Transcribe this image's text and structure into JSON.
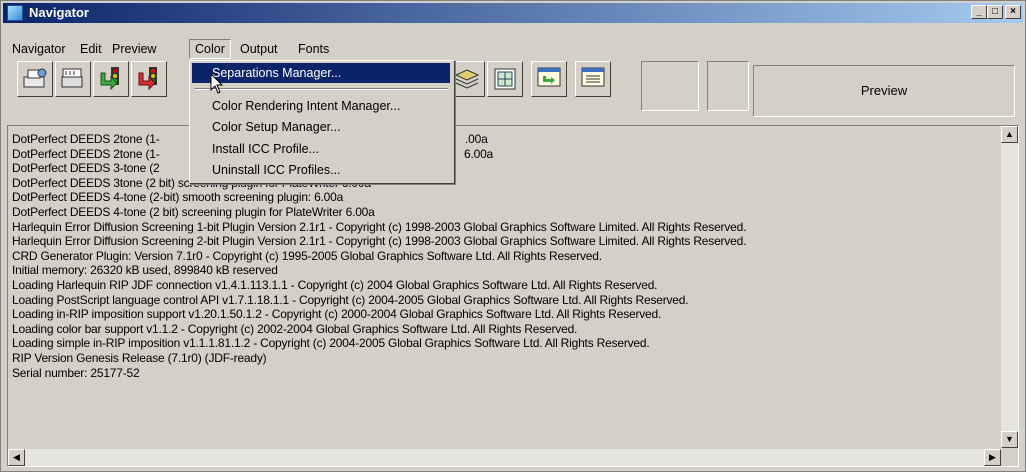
{
  "window": {
    "title": "Navigator"
  },
  "titlebar_buttons": {
    "minimize": "_",
    "maximize": "□",
    "close": "×"
  },
  "menubar": {
    "items": [
      {
        "label": "Navigator"
      },
      {
        "label": "Edit"
      },
      {
        "label": "Preview"
      },
      {
        "label": "Color"
      },
      {
        "label": "Output"
      },
      {
        "label": "Fonts"
      }
    ]
  },
  "toolbar": {
    "icons": [
      "print-job-icon",
      "tape-printer-icon",
      "traffic-light-green-arrow-icon",
      "traffic-light-red-arrow-icon",
      "book-stack-icon",
      "calculator-icon",
      "monitor-arrow-icon",
      "monitor-list-icon"
    ]
  },
  "preview": {
    "label": "Preview"
  },
  "color_menu": {
    "items": [
      {
        "label": "Separations Manager...",
        "highlighted": true
      },
      {
        "label": "Color Rendering Intent Manager..."
      },
      {
        "label": "Color Setup Manager..."
      },
      {
        "label": "Install ICC Profile..."
      },
      {
        "label": "Uninstall ICC Profiles..."
      }
    ]
  },
  "log": {
    "lines": [
      "DotPerfect DEEDS 2tone (1-",
      "DotPerfect DEEDS 2tone (1-",
      "DotPerfect DEEDS 3-tone (2",
      "DotPerfect DEEDS 3tone (2 bit) screening plugin for PlateWriter 6.00a",
      "DotPerfect DEEDS 4-tone (2-bit) smooth screening plugin: 6.00a",
      "DotPerfect DEEDS 4-tone (2 bit) screening plugin for PlateWriter 6.00a",
      "Harlequin Error Diffusion Screening 1-bit Plugin Version 2.1r1 - Copyright (c) 1998-2003 Global Graphics Software Limited. All Rights Reserved.",
      "Harlequin Error Diffusion Screening 2-bit Plugin Version 2.1r1 - Copyright (c) 1998-2003 Global Graphics Software Limited. All Rights Reserved.",
      "CRD Generator Plugin: Version 7.1r0 - Copyright (c) 1995-2005 Global Graphics Software Ltd. All Rights Reserved.",
      "Initial memory: 26320 kB used, 899840 kB reserved",
      "Loading Harlequin RIP JDF connection v1.4.1.113.1.1 - Copyright (c) 2004 Global Graphics Software Ltd. All Rights Reserved.",
      "Loading PostScript language control API v1.7.1.18.1.1 - Copyright (c) 2004-2005 Global Graphics Software Ltd. All Rights Reserved.",
      "Loading in-RIP imposition support v1.20.1.50.1.2 - Copyright (c) 2000-2004 Global Graphics Software Ltd. All Rights Reserved.",
      "Loading color bar support v1.1.2 - Copyright (c) 2002-2004 Global Graphics Software Ltd. All Rights Reserved.",
      "Loading simple in-RIP imposition v1.1.1.81.1.2 - Copyright (c) 2004-2005 Global Graphics Software Ltd. All Rights Reserved.",
      "RIP Version Genesis Release (7.1r0) (JDF-ready)",
      "Serial number: 25177-52"
    ],
    "overlap_fragments": [
      ".00a",
      "6.00a"
    ]
  }
}
